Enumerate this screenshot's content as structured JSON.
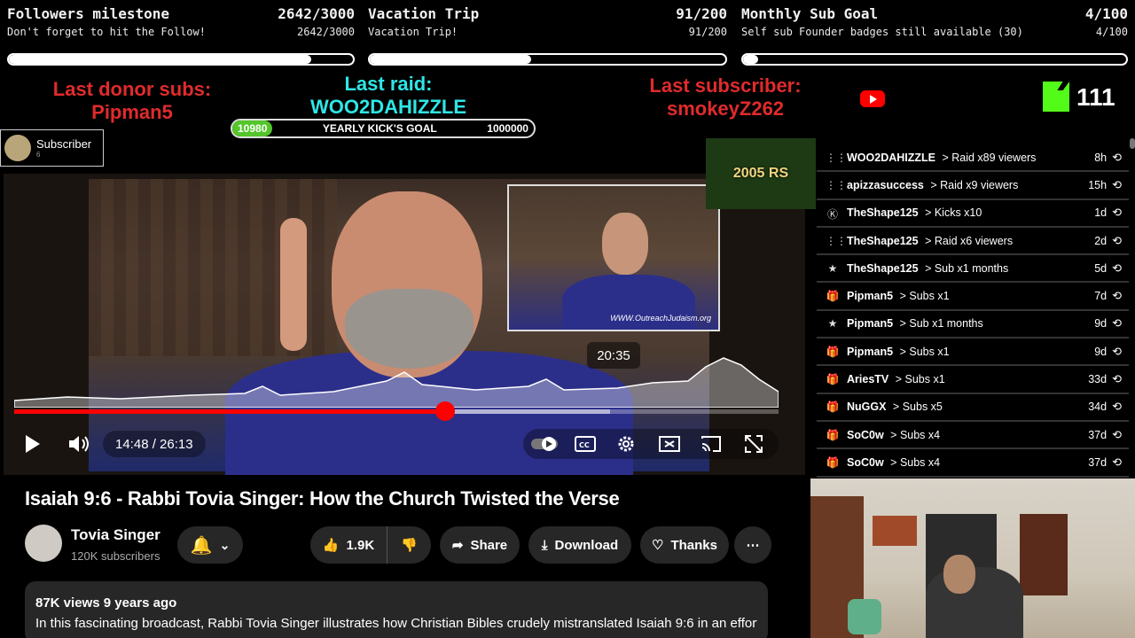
{
  "goals": [
    {
      "title": "Followers milestone",
      "title_value": "2642/3000",
      "subtitle": "Don't forget to hit the Follow!",
      "sub_value": "2642/3000",
      "progress": 0.88
    },
    {
      "title": "Vacation Trip",
      "title_value": "91/200",
      "subtitle": "Vacation Trip!",
      "sub_value": "91/200",
      "progress": 0.455
    },
    {
      "title": "Monthly Sub Goal",
      "title_value": "4/100",
      "subtitle": "Self sub Founder badges still available (30)",
      "sub_value": "4/100",
      "progress": 0.04
    }
  ],
  "last_donor": {
    "label": "Last donor subs:",
    "name": "Pipman5"
  },
  "last_raid": {
    "label": "Last raid:",
    "name": "WOO2DAHIZZLE"
  },
  "last_subscriber": {
    "label": "Last subscriber:",
    "name": "smokeyZ262"
  },
  "kick_goal": {
    "current": "10980",
    "label": "YEARLY KICK'S GOAL",
    "target": "1000000"
  },
  "kick_count": "111",
  "subscriber_alert": {
    "title": "Subscriber",
    "count": "6"
  },
  "overlay_logo": "2005 RS",
  "video": {
    "hover_time": "20:35",
    "time": "14:48 / 26:13",
    "played_fraction": 0.566,
    "buffered_fraction": 0.78,
    "pip_watermark": "WWW.OutreachJudaism.org"
  },
  "title": "Isaiah 9:6 - Rabbi Tovia Singer: How the Church Twisted the Verse",
  "channel": {
    "name": "Tovia Singer",
    "subscribers": "120K subscribers"
  },
  "actions": {
    "likes": "1.9K",
    "share": "Share",
    "download": "Download",
    "thanks": "Thanks"
  },
  "description": {
    "meta": "87K views  9 years ago",
    "text": "In this fascinating broadcast, Rabbi Tovia Singer illustrates how Christian Bibles crudely mistranslated Isaiah 9:6 in an effort to"
  },
  "events": [
    {
      "icon": "raid-icon",
      "who": "WOO2DAHIZZLE",
      "what": "Raid x89 viewers",
      "ago": "8h"
    },
    {
      "icon": "raid-icon",
      "who": "apizzasuccess",
      "what": "Raid x9 viewers",
      "ago": "15h"
    },
    {
      "icon": "kick-icon",
      "who": "TheShape125",
      "what": "Kicks x10",
      "ago": "1d"
    },
    {
      "icon": "raid-icon",
      "who": "TheShape125",
      "what": "Raid x6 viewers",
      "ago": "2d"
    },
    {
      "icon": "star-icon",
      "who": "TheShape125",
      "what": "Sub x1 months",
      "ago": "5d"
    },
    {
      "icon": "gift-icon",
      "who": "Pipman5",
      "what": "Subs x1",
      "ago": "7d"
    },
    {
      "icon": "star-icon",
      "who": "Pipman5",
      "what": "Sub x1 months",
      "ago": "9d"
    },
    {
      "icon": "gift-icon",
      "who": "Pipman5",
      "what": "Subs x1",
      "ago": "9d"
    },
    {
      "icon": "gift-icon",
      "who": "AriesTV",
      "what": "Subs x1",
      "ago": "33d"
    },
    {
      "icon": "gift-icon",
      "who": "NuGGX",
      "what": "Subs x5",
      "ago": "34d"
    },
    {
      "icon": "gift-icon",
      "who": "SoC0w",
      "what": "Subs x4",
      "ago": "37d"
    },
    {
      "icon": "gift-icon",
      "who": "SoC0w",
      "what": "Subs x4",
      "ago": "37d"
    }
  ],
  "colors": {
    "red": "#e02b2b",
    "cyan": "#2ee6e6",
    "kick_green": "#53fc18",
    "yt_red": "#ff0000"
  }
}
